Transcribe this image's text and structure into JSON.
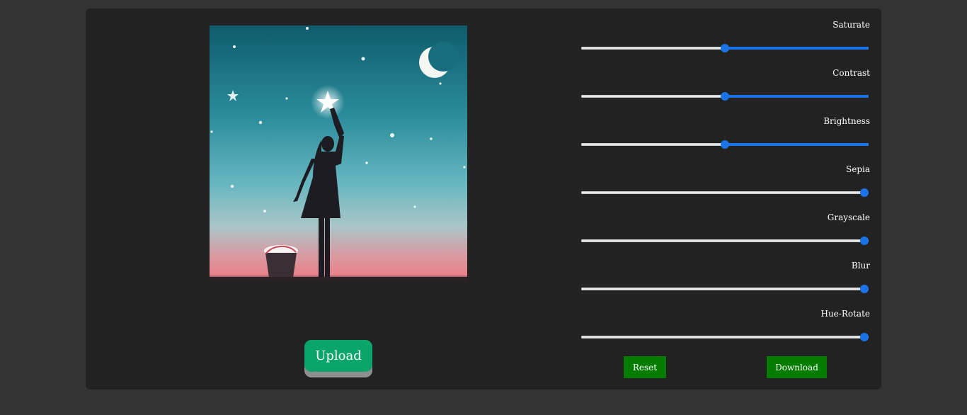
{
  "upload": {
    "label": "Upload"
  },
  "photo": {
    "description_icon": "photo-image"
  },
  "controls": [
    {
      "label": "Saturate",
      "value_fraction": 0.5,
      "filled": "right"
    },
    {
      "label": "Contrast",
      "value_fraction": 0.5,
      "filled": "right"
    },
    {
      "label": "Brightness",
      "value_fraction": 0.5,
      "filled": "right"
    },
    {
      "label": "Sepia",
      "value_fraction": 1.0,
      "filled": "none"
    },
    {
      "label": "Grayscale",
      "value_fraction": 1.0,
      "filled": "none"
    },
    {
      "label": "Blur",
      "value_fraction": 1.0,
      "filled": "none"
    },
    {
      "label": "Hue-Rotate",
      "value_fraction": 1.0,
      "filled": "none"
    }
  ],
  "actions": {
    "reset_label": "Reset",
    "download_label": "Download"
  },
  "colors": {
    "page_bg": "#333333",
    "panel_bg": "#222222",
    "accent": "#1a73e8",
    "upload_button": "#0aa56a",
    "action_button": "#037c00"
  }
}
